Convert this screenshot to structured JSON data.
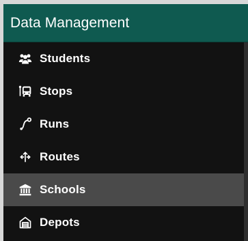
{
  "header": {
    "title": "Data Management"
  },
  "menu": {
    "items": [
      {
        "label": "Students",
        "icon": "users-icon",
        "active": false
      },
      {
        "label": "Stops",
        "icon": "bus-stop-icon",
        "active": false
      },
      {
        "label": "Runs",
        "icon": "route-path-icon",
        "active": false
      },
      {
        "label": "Routes",
        "icon": "split-arrows-icon",
        "active": false
      },
      {
        "label": "Schools",
        "icon": "institution-icon",
        "active": true
      },
      {
        "label": "Depots",
        "icon": "garage-icon",
        "active": false
      }
    ]
  },
  "colors": {
    "header_bg": "#0f5a50",
    "panel_bg": "#121212",
    "active_bg": "#4a4a4a",
    "text": "#ffffff"
  }
}
